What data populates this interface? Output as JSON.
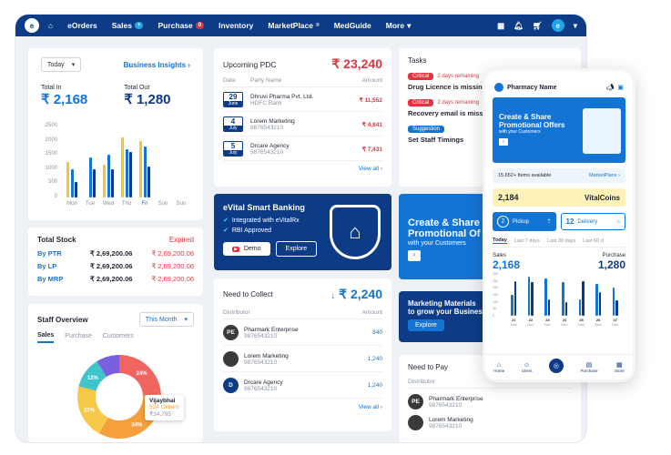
{
  "nav": {
    "logo": "e",
    "items": [
      {
        "label": "eOrders"
      },
      {
        "label": "Sales",
        "badge": "+"
      },
      {
        "label": "Purchase",
        "badge": "0"
      },
      {
        "label": "Inventory"
      },
      {
        "label": "MarketPlace",
        "sup": "®"
      },
      {
        "label": "MedGuide"
      },
      {
        "label": "More"
      }
    ],
    "avatar": "e"
  },
  "insights": {
    "period": "Today",
    "link": "Business Insights",
    "total_in_label": "Total In",
    "total_in": "₹ 2,168",
    "total_out_label": "Total Out",
    "total_out": "₹ 1,280",
    "chart_data": {
      "type": "bar",
      "categories": [
        "Mon",
        "Tue",
        "Wed",
        "Thu",
        "Fri",
        "Sun",
        "Sun"
      ],
      "y_ticks": [
        "2500",
        "2000",
        "1500",
        "1000",
        "500",
        "0"
      ],
      "ylim": [
        0,
        2500
      ],
      "series": [
        {
          "color": "#f5c430",
          "values": [
            1250,
            0,
            1150,
            2100,
            2000,
            0,
            0
          ]
        },
        {
          "color": "#1474d4",
          "values": [
            1000,
            1400,
            1500,
            1700,
            1800,
            0,
            0
          ]
        },
        {
          "color": "#0d3b86",
          "values": [
            550,
            1000,
            1000,
            1600,
            1100,
            0,
            0
          ]
        }
      ]
    }
  },
  "stock": {
    "title": "Total Stock",
    "expired": "Expired",
    "rows": [
      {
        "label": "By PTR",
        "value": "₹ 2,69,200.06",
        "expired": "₹ 2,69,200.06"
      },
      {
        "label": "By LP",
        "value": "₹ 2,69,200.06",
        "expired": "₹ 2,69,200.06"
      },
      {
        "label": "By MRP",
        "value": "₹ 2,69,200.06",
        "expired": "₹ 2,69,200.06"
      }
    ]
  },
  "staff": {
    "title": "Staff Overview",
    "period": "This Month",
    "tabs": [
      "Sales",
      "Purchase",
      "Customers"
    ],
    "donut": [
      {
        "label": "24%",
        "value": 24,
        "color": "#f0655f"
      },
      {
        "label": "34%",
        "value": 34,
        "color": "#f5a03c"
      },
      {
        "label": "21%",
        "value": 21,
        "color": "#f7c948"
      },
      {
        "label": "12%",
        "value": 12,
        "color": "#3fc4c9"
      },
      {
        "label": "",
        "value": 9,
        "color": "#7a5fe0"
      }
    ],
    "tooltip": {
      "name": "Vijaybhai",
      "orders": "524 Orders",
      "amount": "₹34,795"
    }
  },
  "pdc": {
    "title": "Upcoming PDC",
    "total": "₹ 23,240",
    "cols": [
      "Date",
      "Party Name",
      "Amount"
    ],
    "rows": [
      {
        "day": "29",
        "month": "June",
        "name": "Dhruvi Pharma Pvt. Ltd.",
        "sub": "HDFC Bank",
        "amount": "₹ 11,552"
      },
      {
        "day": "4",
        "month": "July",
        "name": "Lorem Marketing",
        "sub": "9876543210",
        "amount": "₹ 4,841"
      },
      {
        "day": "5",
        "month": "July",
        "name": "Drcare Agency",
        "sub": "9876543210",
        "amount": "₹ 7,431"
      }
    ],
    "view_all": "View all"
  },
  "banking": {
    "title": "eVital Smart Banking",
    "lines": [
      "Integrated with eVitalRx",
      "RBI Approved"
    ],
    "demo": "Demo",
    "explore": "Explore"
  },
  "collect": {
    "title": "Need to Collect",
    "total": "₹ 2,240",
    "cols": [
      "Distributor",
      "Amount"
    ],
    "rows": [
      {
        "name": "Pharmark Enterprise",
        "sub": "9876543210",
        "amount": "840",
        "logo": "PE"
      },
      {
        "name": "Lorem Marketing",
        "sub": "9876543210",
        "amount": "1,240",
        "logo": ""
      },
      {
        "name": "Drcare Agency",
        "sub": "9876543210",
        "amount": "1,240",
        "logo": "D"
      }
    ],
    "view_all": "View all"
  },
  "tasks": {
    "title": "Tasks",
    "items": [
      {
        "tag": "Critical",
        "tag_color": "#e2343f",
        "time": "2 days remaining",
        "text": "Drug Licence is missing"
      },
      {
        "tag": "Critical",
        "tag_color": "#e2343f",
        "time": "2 days remaining",
        "text": "Recovery email is missing"
      },
      {
        "tag": "Suggestion",
        "tag_color": "#1474d4",
        "time": "",
        "text": "Set Staff Timings"
      }
    ]
  },
  "promo": {
    "line1": "Create & Share",
    "line2": "Promotional Of",
    "line3": "with your Customers"
  },
  "materials": {
    "line1": "Marketing Materials",
    "line2": "to grow your Business",
    "explore": "Explore"
  },
  "pay": {
    "title": "Need to Pay",
    "col": "Distributor",
    "rows": [
      {
        "name": "Pharmark Enterprise",
        "sub": "9876543210",
        "logo": "PE"
      },
      {
        "name": "Lorem Marketing",
        "sub": "9876543210",
        "logo": ""
      }
    ]
  },
  "phone": {
    "title": "Pharmacy Name",
    "banner1": "Create & Share",
    "banner2": "Promotional Offers",
    "banner3": "with your Customers",
    "items": "15,652+ Items available",
    "marketplace": "MarketPlace",
    "coins": "2,184",
    "coins_label": "VitalCoins",
    "pickup_n": "2",
    "pickup": "Pickup",
    "delivery_n": "12",
    "delivery": "Delivery",
    "tabs": [
      "Today",
      "Last 7 days",
      "Last 30 days",
      "Last 60 d"
    ],
    "sales_label": "Sales",
    "sales": "2,168",
    "purchase_label": "Purchase",
    "purchase": "1,280",
    "y_ticks": [
      "300",
      "250",
      "200",
      "150",
      "100",
      "50",
      "0"
    ],
    "chart_data": {
      "type": "bar",
      "categories": [
        "21",
        "22",
        "23",
        "24",
        "25",
        "26",
        "27"
      ],
      "category_sub": [
        "Dec",
        "Dec",
        "Dec",
        "Dec",
        "Dec",
        "Dec",
        "Dec"
      ],
      "ylim": [
        0,
        300
      ],
      "series": [
        {
          "color": "#1474d4",
          "values": [
            150,
            280,
            270,
            240,
            120,
            230,
            200
          ]
        },
        {
          "color": "#0d3b86",
          "values": [
            250,
            240,
            120,
            100,
            250,
            170,
            110
          ]
        }
      ]
    },
    "bottom": [
      "Home",
      "Users",
      "",
      "Purchase",
      "Store"
    ]
  }
}
